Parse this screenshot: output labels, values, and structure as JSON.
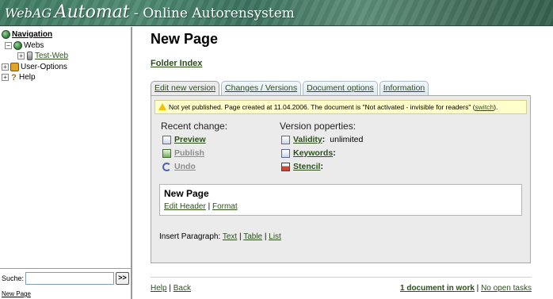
{
  "header": {
    "brand_small": "WebAG",
    "brand_big": "Automat",
    "title_rest": " - Online Autorensystem"
  },
  "nav": {
    "root_label": "Navigation",
    "items": [
      {
        "label": "Webs",
        "icon": "globe-icon"
      },
      {
        "label": "Test-Web",
        "icon": "database-icon"
      },
      {
        "label": "User-Options",
        "icon": "lock-icon"
      },
      {
        "label": "Help",
        "icon": "help-icon"
      }
    ],
    "search_label": "Suche:",
    "search_value": "",
    "search_button": ">>",
    "footer_link": "New Page"
  },
  "main": {
    "page_title": "New Page",
    "folder_index": "Folder Index",
    "tabs": [
      {
        "label": "Edit new version",
        "active": true
      },
      {
        "label": "Changes / Versions"
      },
      {
        "label": "Document options"
      },
      {
        "label": "Information"
      }
    ],
    "notice": {
      "text_before": "Not yet published. Page created at 11.04.2006.    The document is \"Not activated - invisible for readers\" (",
      "link": "switch",
      "text_after": ")."
    },
    "recent_change": {
      "heading": "Recent change:",
      "actions": [
        {
          "label": "Preview",
          "icon": "preview-icon",
          "enabled": true
        },
        {
          "label": "Publish",
          "icon": "publish-icon",
          "enabled": false
        },
        {
          "label": "Undo",
          "icon": "undo-icon",
          "enabled": false
        }
      ]
    },
    "version_properties": {
      "heading": "Version poperties:",
      "items": [
        {
          "label": "Validity",
          "suffix": ":",
          "value": "unlimited",
          "icon": "validity-icon"
        },
        {
          "label": "Keywords",
          "suffix": ":",
          "value": "",
          "icon": "keywords-icon"
        },
        {
          "label": "Stencil",
          "suffix": ":",
          "value": "",
          "icon": "stencil-icon"
        }
      ]
    },
    "content_block": {
      "title": "New Page",
      "edit_header": "Edit Header",
      "separator": " | ",
      "format": "Format"
    },
    "insert_paragraph": {
      "label": "Insert Paragraph: ",
      "text": "Text",
      "table": "Table",
      "list": "List",
      "separator": " | "
    },
    "footer": {
      "help": "Help",
      "back": "Back",
      "separator": " | ",
      "documents_in_work": "1 document in work",
      "open_tasks": "No open tasks"
    }
  }
}
